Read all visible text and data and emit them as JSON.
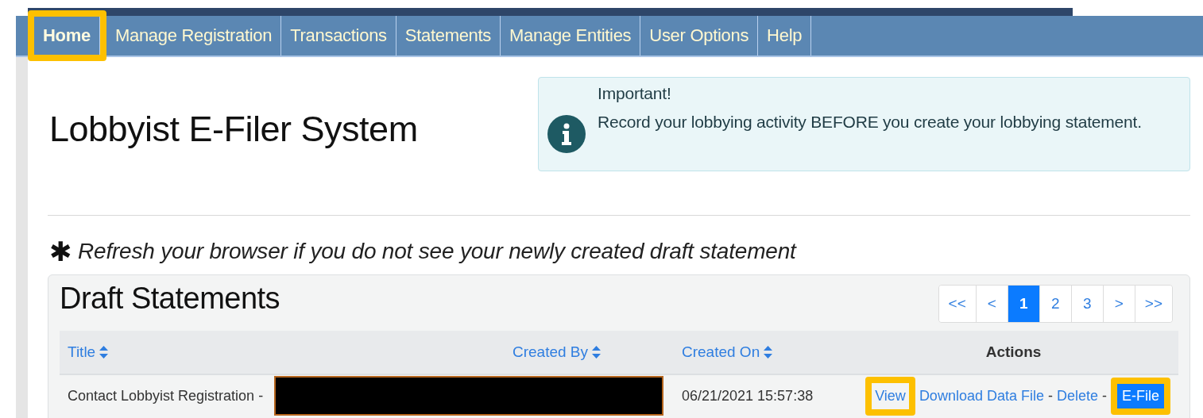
{
  "nav": {
    "items": [
      {
        "label": "Home",
        "selected": true,
        "highlighted": true
      },
      {
        "label": "Manage Registration",
        "selected": false,
        "highlighted": false
      },
      {
        "label": "Transactions",
        "selected": false,
        "highlighted": false
      },
      {
        "label": "Statements",
        "selected": false,
        "highlighted": false
      },
      {
        "label": "Manage Entities",
        "selected": false,
        "highlighted": false
      },
      {
        "label": "User Options",
        "selected": false,
        "highlighted": false
      },
      {
        "label": "Help",
        "selected": false,
        "highlighted": false
      }
    ]
  },
  "page_title": "Lobbyist E-Filer System",
  "alert": {
    "heading": "Important!",
    "message": "Record your lobbying activity BEFORE you create your lobbying statement."
  },
  "note": {
    "mark": "✱",
    "text": "Refresh your browser if you do not see your newly created draft statement"
  },
  "draft_statements": {
    "heading": "Draft Statements",
    "pagination": [
      {
        "label": "<<",
        "selected": false
      },
      {
        "label": "<",
        "selected": false
      },
      {
        "label": "1",
        "selected": true
      },
      {
        "label": "2",
        "selected": false
      },
      {
        "label": "3",
        "selected": false
      },
      {
        "label": ">",
        "selected": false
      },
      {
        "label": ">>",
        "selected": false
      }
    ],
    "columns": [
      {
        "label": "Title",
        "sortable": true
      },
      {
        "label": "Created By",
        "sortable": true
      },
      {
        "label": "Created On",
        "sortable": true
      },
      {
        "label": "Actions",
        "sortable": false
      }
    ],
    "rows": [
      {
        "title": "Contact Lobbyist Registration -",
        "created_by_redacted": true,
        "created_on": "06/21/2021 15:57:38",
        "actions": [
          {
            "kind": "link",
            "label": "View",
            "highlighted": true
          },
          {
            "kind": "link",
            "label": "Download Data File",
            "highlighted": false
          },
          {
            "kind": "separator",
            "label": "-"
          },
          {
            "kind": "link",
            "label": "Delete",
            "highlighted": false
          },
          {
            "kind": "separator",
            "label": "-"
          },
          {
            "kind": "button",
            "label": "E-File",
            "highlighted": true
          }
        ]
      }
    ]
  }
}
